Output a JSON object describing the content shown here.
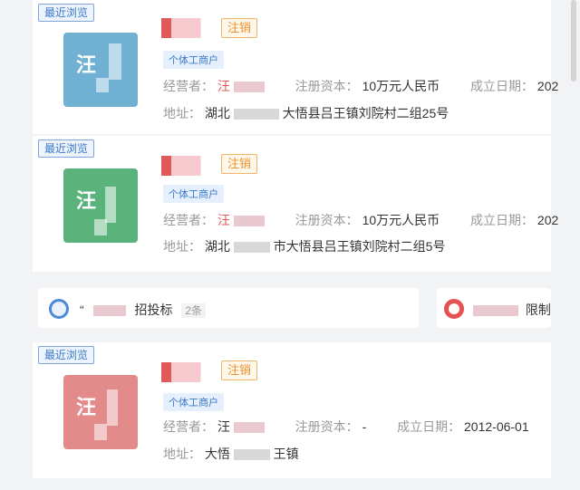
{
  "cards": [
    {
      "badge": "最近浏览",
      "logo_char": "汪",
      "status": "注销",
      "tag": "个体工商户",
      "operator_label": "经营者：",
      "operator_value": "汪",
      "capital_label": "注册资本：",
      "capital_value": "10万元人民币",
      "date_label": "成立日期：",
      "date_value": "202",
      "addr_label": "地址：",
      "addr_prefix": "湖北",
      "addr_suffix": "大悟县吕王镇刘院村二组25号",
      "logo_color": "#6fb0d3"
    },
    {
      "badge": "最近浏览",
      "logo_char": "汪",
      "status": "注销",
      "tag": "个体工商户",
      "operator_label": "经营者：",
      "operator_value": "汪",
      "capital_label": "注册资本：",
      "capital_value": "10万元人民币",
      "date_label": "成立日期：",
      "date_value": "202",
      "addr_label": "地址：",
      "addr_prefix": "湖北",
      "addr_suffix": "市大悟县吕王镇刘院村二组5号",
      "logo_color": "#5bb37c"
    },
    {
      "badge": "最近浏览",
      "logo_char": "汪",
      "status": "注销",
      "tag": "个体工商户",
      "operator_label": "经营者：",
      "operator_value": "汪",
      "capital_label": "注册资本：",
      "capital_value": "-",
      "date_label": "成立日期：",
      "date_value": "2012-06-01",
      "addr_label": "地址：",
      "addr_prefix": "大悟",
      "addr_suffix": "王镇",
      "logo_color": "#e38b8b"
    }
  ],
  "strip": {
    "left_text": "“",
    "left_suffix": "招投标",
    "left_count": "2条",
    "right_suffix": "限制"
  }
}
